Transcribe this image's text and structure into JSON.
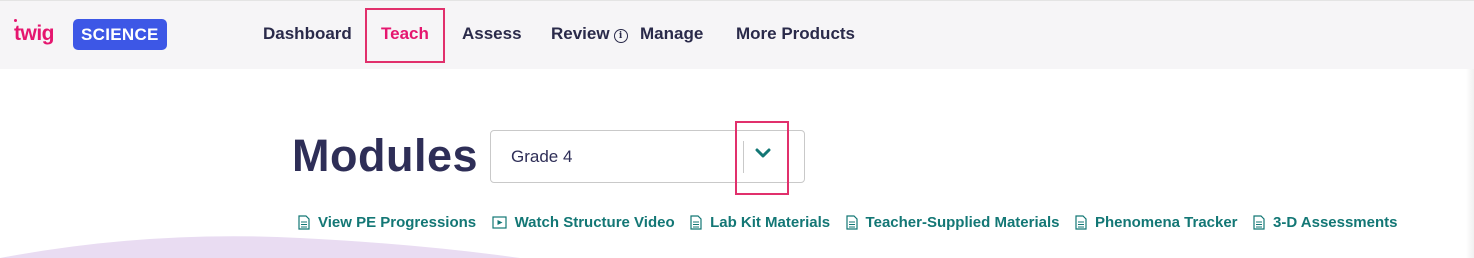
{
  "brand": {
    "twig": "twig",
    "science": "SCIENCE"
  },
  "nav": {
    "dashboard": "Dashboard",
    "teach": "Teach",
    "assess": "Assess",
    "review": "Review",
    "manage": "Manage",
    "more_products": "More Products"
  },
  "page": {
    "title": "Modules"
  },
  "grade_select": {
    "value": "Grade 4"
  },
  "resource_links": {
    "pe_progressions": "View PE Progressions",
    "structure_video": "Watch Structure Video",
    "lab_kit": "Lab Kit Materials",
    "teacher_supplied": "Teacher-Supplied Materials",
    "phenomena_tracker": "Phenomena Tracker",
    "assessments_3d": "3-D Assessments"
  },
  "icons": {
    "info": "info-icon",
    "document": "document-icon",
    "video": "video-icon",
    "chevron": "chevron-down-icon"
  },
  "colors": {
    "accent": "#e5166f",
    "brand_blue": "#3d57e6",
    "link_teal": "#137775",
    "title_navy": "#2e2e57"
  }
}
